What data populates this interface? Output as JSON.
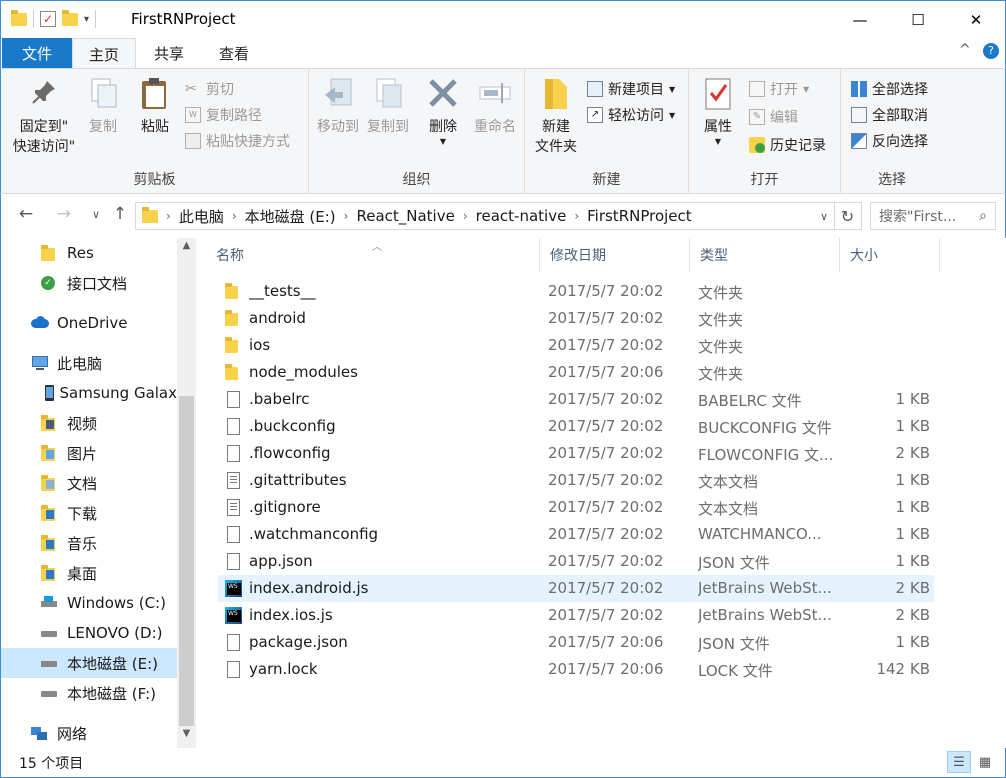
{
  "window": {
    "title": "FirstRNProject",
    "minimize": "—",
    "maximize": "☐",
    "close": "✕"
  },
  "ribbon_tabs": {
    "file": "文件",
    "home": "主页",
    "share": "共享",
    "view": "查看",
    "collapse": "^",
    "help": "?"
  },
  "ribbon": {
    "clipboard": {
      "label": "剪贴板",
      "pin": "固定到\"\n快速访问\"",
      "pin_line1": "固定到\"",
      "pin_line2": "快速访问\"",
      "copy": "复制",
      "paste": "粘贴",
      "cut": "剪切",
      "copy_path": "复制路径",
      "paste_shortcut": "粘贴快捷方式"
    },
    "organize": {
      "label": "组织",
      "move_to": "移动到",
      "copy_to": "复制到",
      "delete": "删除",
      "rename": "重命名"
    },
    "new": {
      "label": "新建",
      "new_folder_line1": "新建",
      "new_folder_line2": "文件夹",
      "new_item": "新建项目",
      "easy_access": "轻松访问"
    },
    "open": {
      "label": "打开",
      "properties": "属性",
      "open": "打开",
      "edit": "编辑",
      "history": "历史记录"
    },
    "select": {
      "label": "选择",
      "select_all": "全部选择",
      "select_none": "全部取消",
      "invert": "反向选择"
    }
  },
  "address": {
    "crumbs": [
      "此电脑",
      "本地磁盘 (E:)",
      "React_Native",
      "react-native",
      "FirstRNProject"
    ],
    "search_placeholder": "搜索\"First..."
  },
  "sidebar": {
    "items": [
      {
        "label": "Res",
        "icon": "folder-icon"
      },
      {
        "label": "接口文档",
        "icon": "sync-folder-icon"
      },
      {
        "label": "OneDrive",
        "icon": "onedrive-icon"
      },
      {
        "label": "此电脑",
        "icon": "computer-icon"
      },
      {
        "label": "Samsung Galax",
        "icon": "phone-icon"
      },
      {
        "label": "视频",
        "icon": "videos-icon"
      },
      {
        "label": "图片",
        "icon": "pictures-icon"
      },
      {
        "label": "文档",
        "icon": "documents-icon"
      },
      {
        "label": "下载",
        "icon": "downloads-icon"
      },
      {
        "label": "音乐",
        "icon": "music-icon"
      },
      {
        "label": "桌面",
        "icon": "desktop-icon"
      },
      {
        "label": "Windows (C:)",
        "icon": "windows-drive-icon"
      },
      {
        "label": "LENOVO (D:)",
        "icon": "drive-icon"
      },
      {
        "label": "本地磁盘 (E:)",
        "icon": "drive-icon"
      },
      {
        "label": "本地磁盘 (F:)",
        "icon": "drive-icon"
      },
      {
        "label": "网络",
        "icon": "network-icon"
      }
    ],
    "selected_index": 13
  },
  "columns": {
    "name": "名称",
    "date": "修改日期",
    "type": "类型",
    "size": "大小"
  },
  "files": [
    {
      "name": "__tests__",
      "date": "2017/5/7 20:02",
      "type": "文件夹",
      "size": "",
      "icon": "folder-icon"
    },
    {
      "name": "android",
      "date": "2017/5/7 20:02",
      "type": "文件夹",
      "size": "",
      "icon": "folder-icon"
    },
    {
      "name": "ios",
      "date": "2017/5/7 20:02",
      "type": "文件夹",
      "size": "",
      "icon": "folder-icon"
    },
    {
      "name": "node_modules",
      "date": "2017/5/7 20:06",
      "type": "文件夹",
      "size": "",
      "icon": "folder-icon"
    },
    {
      "name": ".babelrc",
      "date": "2017/5/7 20:02",
      "type": "BABELRC 文件",
      "size": "1 KB",
      "icon": "file-icon"
    },
    {
      "name": ".buckconfig",
      "date": "2017/5/7 20:02",
      "type": "BUCKCONFIG 文件",
      "size": "1 KB",
      "icon": "file-icon"
    },
    {
      "name": ".flowconfig",
      "date": "2017/5/7 20:02",
      "type": "FLOWCONFIG 文...",
      "size": "2 KB",
      "icon": "file-icon"
    },
    {
      "name": ".gitattributes",
      "date": "2017/5/7 20:02",
      "type": "文本文档",
      "size": "1 KB",
      "icon": "text-file-icon"
    },
    {
      "name": ".gitignore",
      "date": "2017/5/7 20:02",
      "type": "文本文档",
      "size": "1 KB",
      "icon": "text-file-icon"
    },
    {
      "name": ".watchmanconfig",
      "date": "2017/5/7 20:02",
      "type": "WATCHMANCO...",
      "size": "1 KB",
      "icon": "file-icon"
    },
    {
      "name": "app.json",
      "date": "2017/5/7 20:02",
      "type": "JSON 文件",
      "size": "1 KB",
      "icon": "file-icon"
    },
    {
      "name": "index.android.js",
      "date": "2017/5/7 20:02",
      "type": "JetBrains WebSt...",
      "size": "2 KB",
      "icon": "webstorm-icon"
    },
    {
      "name": "index.ios.js",
      "date": "2017/5/7 20:02",
      "type": "JetBrains WebSt...",
      "size": "2 KB",
      "icon": "webstorm-icon"
    },
    {
      "name": "package.json",
      "date": "2017/5/7 20:06",
      "type": "JSON 文件",
      "size": "1 KB",
      "icon": "file-icon"
    },
    {
      "name": "yarn.lock",
      "date": "2017/5/7 20:06",
      "type": "LOCK 文件",
      "size": "142 KB",
      "icon": "file-icon"
    }
  ],
  "hovered_file_index": 11,
  "status": {
    "item_count": "15 个项目"
  },
  "colors": {
    "accent": "#1979ca",
    "selection": "#cce8ff",
    "hover": "#e5f3ff",
    "window_border": "#3c8fd6"
  }
}
